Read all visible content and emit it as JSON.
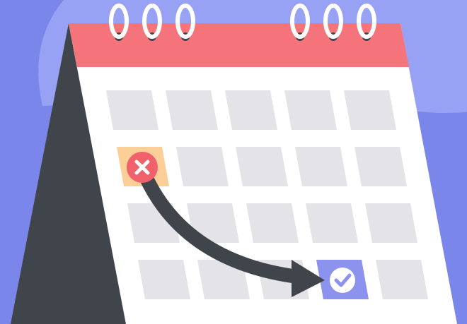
{
  "illustration": {
    "icons": {
      "calendar": "desk-calendar-icon",
      "cancelled_day": "cancel-x-icon",
      "rescheduled_day": "checkmark-icon",
      "move_arrow": "curved-arrow-icon"
    },
    "grid": {
      "rows": 4,
      "columns": 5,
      "cancelled_cell": {
        "row": 2,
        "column": 1
      },
      "rescheduled_cell": {
        "row": 4,
        "column": 4
      }
    },
    "colors": {
      "background": "#7b86ea",
      "background_blob": "#98a2f4",
      "calendar_header": "#f5737b",
      "calendar_page": "#ffffff",
      "calendar_stand": "#40444b",
      "day_cell": "#e3e3e8",
      "cancelled_cell": "#fccf98",
      "cancel_badge": "#f0616b",
      "rescheduled_cell": "#8c93ef",
      "arrow": "#40444b",
      "rings": "#ffffff"
    }
  }
}
